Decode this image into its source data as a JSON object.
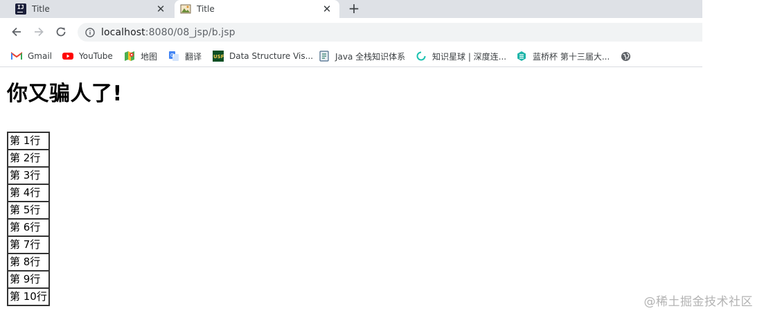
{
  "browser": {
    "tabs": [
      {
        "title": "Title",
        "icon": "intellij-icon",
        "active": false
      },
      {
        "title": "Title",
        "icon": "image-icon",
        "active": true
      }
    ],
    "new_tab_label": "+",
    "close_label": "✕",
    "url_host": "localhost",
    "url_path": ":8080/08_jsp/b.jsp",
    "bookmarks": [
      {
        "label": "Gmail",
        "icon": "gmail-icon"
      },
      {
        "label": "YouTube",
        "icon": "youtube-icon"
      },
      {
        "label": "地图",
        "icon": "maps-icon"
      },
      {
        "label": "翻译",
        "icon": "translate-icon"
      },
      {
        "label": "Data Structure Vis...",
        "icon": "usf-icon"
      },
      {
        "label": "Java 全栈知识体系",
        "icon": "java-icon"
      },
      {
        "label": "知识星球 | 深度连...",
        "icon": "zsxq-icon"
      },
      {
        "label": "蓝桥杯 第十三届大...",
        "icon": "lanqiao-icon"
      },
      {
        "label": "",
        "icon": "globe-icon"
      }
    ]
  },
  "page": {
    "heading": "你又骗人了!",
    "rows": [
      "第 1行",
      "第 2行",
      "第 3行",
      "第 4行",
      "第 5行",
      "第 6行",
      "第 7行",
      "第 8行",
      "第 9行",
      "第 10行"
    ],
    "watermark": "@稀土掘金技术社区"
  },
  "colors": {
    "tabstrip": "#dee1e6",
    "omnibox": "#f1f3f4",
    "youtube_red": "#ff0000",
    "gmail_red": "#ea4335"
  }
}
